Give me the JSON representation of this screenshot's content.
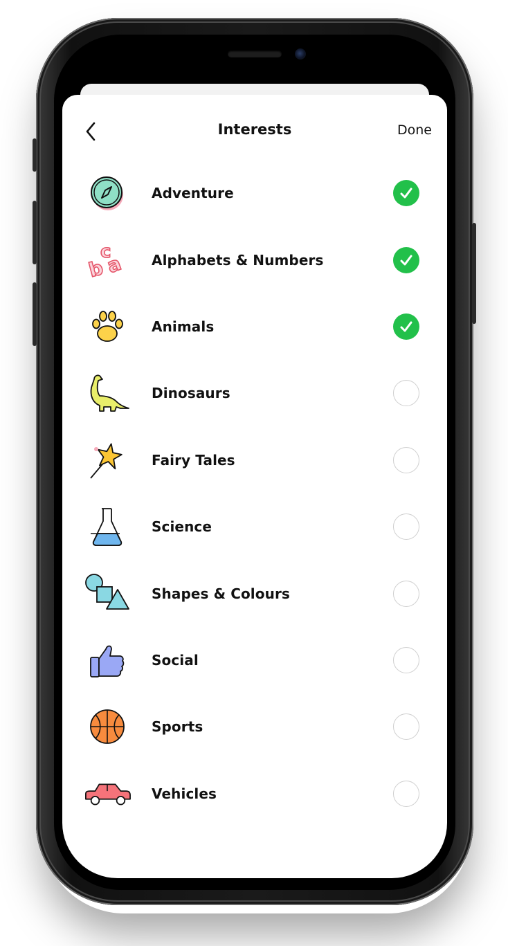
{
  "header": {
    "title": "Interests",
    "done_label": "Done"
  },
  "interests": [
    {
      "label": "Adventure",
      "icon": "compass-icon",
      "selected": true
    },
    {
      "label": "Alphabets & Numbers",
      "icon": "letters-icon",
      "selected": true
    },
    {
      "label": "Animals",
      "icon": "paw-icon",
      "selected": true
    },
    {
      "label": "Dinosaurs",
      "icon": "dinosaur-icon",
      "selected": false
    },
    {
      "label": "Fairy Tales",
      "icon": "magic-wand-icon",
      "selected": false
    },
    {
      "label": "Science",
      "icon": "flask-icon",
      "selected": false
    },
    {
      "label": "Shapes & Colours",
      "icon": "shapes-icon",
      "selected": false
    },
    {
      "label": "Social",
      "icon": "thumbs-up-icon",
      "selected": false
    },
    {
      "label": "Sports",
      "icon": "basketball-icon",
      "selected": false
    },
    {
      "label": "Vehicles",
      "icon": "car-icon",
      "selected": false
    }
  ],
  "colors": {
    "selected_check": "#22c04a",
    "unselected_ring": "#cfcfcf",
    "text": "#111111"
  }
}
